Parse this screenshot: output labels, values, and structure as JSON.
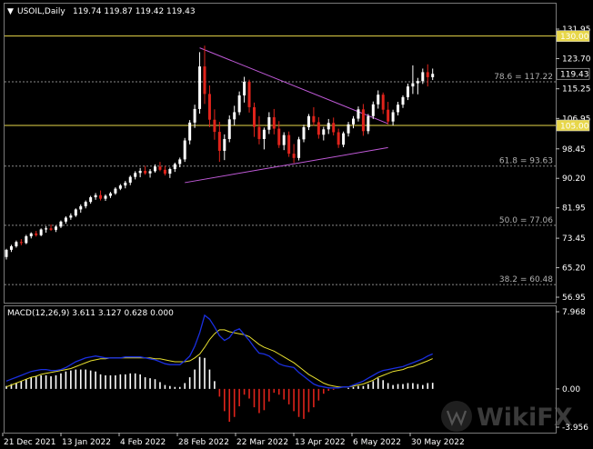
{
  "header": {
    "menu_glyph": "▼",
    "symbol": "USOIL,Daily",
    "ohlc": "119.74 119.87 119.42 119.43"
  },
  "price_axis": {
    "ticks": [
      "131.95",
      "123.70",
      "115.25",
      "106.95",
      "98.45",
      "90.20",
      "81.95",
      "73.45",
      "65.20",
      "56.95"
    ],
    "ylim": [
      56.95,
      131.95
    ],
    "level_130": "130.00",
    "level_105": "105.00",
    "current_price": "119.43"
  },
  "fibonacci": [
    {
      "label": "78.6 = 117.22",
      "value": 117.22
    },
    {
      "label": "61.8 = 93.63",
      "value": 93.63
    },
    {
      "label": "50.0 = 77.06",
      "value": 77.06
    },
    {
      "label": "38.2 = 60.48",
      "value": 60.48
    }
  ],
  "macd": {
    "label": "MACD(12,26,9) 3.611 3.127 0.628 0.000",
    "ticks": [
      "7.968",
      "0.00",
      "-3.956"
    ],
    "ylim": [
      -3.956,
      7.968
    ]
  },
  "time_axis": {
    "labels": [
      "21 Dec 2021",
      "13 Jan 2022",
      "4 Feb 2022",
      "28 Feb 2022",
      "22 Mar 2022",
      "13 Apr 2022",
      "6 May 2022",
      "30 May 2022"
    ]
  },
  "watermark": {
    "text": "WikiFX"
  },
  "colors": {
    "background": "#000000",
    "bull": "#ffffff",
    "bear": "#e0231b",
    "level_line": "#e8d74a",
    "fib_line": "#8a8a8a",
    "trendline": "#c05ad8",
    "macd_line": "#1a2fe0",
    "signal_line": "#e8e030",
    "hist_pos": "#ffffff",
    "hist_neg": "#e0231b"
  },
  "chart_data": {
    "type": "candlestick",
    "title": "USOIL,Daily",
    "candles": [
      [
        68.2,
        70.5,
        67.5,
        70.2
      ],
      [
        70.2,
        71.6,
        69.6,
        71.2
      ],
      [
        71.2,
        72.8,
        70.8,
        72.4
      ],
      [
        72.4,
        73.2,
        71.5,
        72.1
      ],
      [
        72.1,
        74.4,
        71.8,
        74.0
      ],
      [
        74.0,
        75.1,
        73.4,
        74.8
      ],
      [
        74.8,
        75.5,
        73.9,
        74.3
      ],
      [
        74.3,
        76.2,
        74.0,
        75.9
      ],
      [
        75.9,
        76.8,
        75.0,
        76.2
      ],
      [
        76.2,
        77.3,
        75.5,
        75.8
      ],
      [
        75.8,
        77.0,
        75.2,
        76.7
      ],
      [
        76.7,
        78.4,
        76.3,
        78.1
      ],
      [
        78.1,
        79.6,
        77.5,
        79.2
      ],
      [
        79.2,
        80.4,
        78.6,
        79.8
      ],
      [
        79.8,
        81.8,
        79.4,
        81.5
      ],
      [
        81.5,
        82.9,
        80.6,
        82.4
      ],
      [
        82.4,
        84.0,
        81.8,
        83.6
      ],
      [
        83.6,
        85.3,
        83.1,
        84.9
      ],
      [
        84.9,
        86.1,
        84.2,
        85.5
      ],
      [
        85.5,
        86.8,
        84.0,
        84.5
      ],
      [
        84.5,
        85.7,
        83.9,
        85.3
      ],
      [
        85.3,
        86.4,
        84.7,
        86.0
      ],
      [
        86.0,
        87.7,
        85.6,
        87.3
      ],
      [
        87.3,
        88.6,
        86.9,
        88.2
      ],
      [
        88.2,
        89.5,
        87.4,
        89.0
      ],
      [
        89.0,
        91.0,
        88.3,
        90.6
      ],
      [
        90.6,
        92.2,
        89.9,
        91.7
      ],
      [
        91.7,
        93.1,
        90.5,
        92.3
      ],
      [
        92.3,
        93.7,
        91.2,
        91.6
      ],
      [
        91.6,
        92.8,
        90.4,
        92.2
      ],
      [
        92.2,
        94.1,
        91.8,
        93.5
      ],
      [
        93.5,
        94.8,
        92.2,
        92.6
      ],
      [
        92.6,
        93.7,
        91.0,
        91.5
      ],
      [
        91.5,
        93.2,
        90.3,
        92.8
      ],
      [
        92.8,
        94.6,
        92.0,
        94.2
      ],
      [
        94.2,
        96.0,
        93.3,
        95.5
      ],
      [
        95.5,
        101.5,
        94.8,
        100.8
      ],
      [
        100.8,
        106.5,
        99.7,
        105.8
      ],
      [
        105.8,
        110.8,
        104.3,
        109.6
      ],
      [
        109.6,
        125.5,
        108.3,
        121.5
      ],
      [
        121.5,
        127.3,
        111.0,
        113.8
      ],
      [
        113.8,
        116.2,
        104.5,
        106.6
      ],
      [
        106.6,
        109.5,
        101.0,
        103.2
      ],
      [
        103.2,
        106.0,
        94.8,
        97.9
      ],
      [
        97.9,
        102.5,
        95.3,
        101.2
      ],
      [
        101.2,
        107.8,
        100.3,
        106.7
      ],
      [
        106.7,
        110.5,
        105.0,
        108.7
      ],
      [
        108.7,
        114.5,
        107.9,
        113.4
      ],
      [
        113.4,
        118.6,
        111.4,
        117.2
      ],
      [
        117.2,
        117.8,
        108.6,
        110.1
      ],
      [
        110.1,
        111.4,
        101.8,
        104.6
      ],
      [
        104.6,
        107.6,
        99.7,
        101.2
      ],
      [
        101.2,
        104.4,
        98.3,
        103.8
      ],
      [
        103.8,
        108.7,
        102.6,
        107.3
      ],
      [
        107.3,
        109.6,
        102.5,
        104.1
      ],
      [
        104.1,
        106.2,
        98.7,
        99.5
      ],
      [
        99.5,
        103.1,
        98.1,
        102.3
      ],
      [
        102.3,
        103.3,
        96.2,
        97.1
      ],
      [
        97.1,
        99.8,
        94.5,
        95.9
      ],
      [
        95.9,
        101.8,
        95.2,
        101.1
      ],
      [
        101.1,
        105.2,
        100.3,
        104.5
      ],
      [
        104.5,
        108.2,
        103.7,
        107.6
      ],
      [
        107.6,
        110.1,
        104.9,
        105.9
      ],
      [
        105.9,
        107.3,
        101.3,
        102.4
      ],
      [
        102.4,
        104.6,
        100.8,
        103.9
      ],
      [
        103.9,
        106.8,
        102.6,
        105.7
      ],
      [
        105.7,
        107.2,
        102.2,
        103.1
      ],
      [
        103.1,
        104.1,
        98.7,
        99.6
      ],
      [
        99.6,
        103.3,
        98.9,
        102.8
      ],
      [
        102.8,
        106.0,
        101.9,
        105.3
      ],
      [
        105.3,
        107.6,
        104.2,
        106.9
      ],
      [
        106.9,
        110.3,
        106.1,
        109.5
      ],
      [
        109.5,
        111.0,
        102.1,
        103.4
      ],
      [
        103.4,
        108.2,
        102.6,
        107.6
      ],
      [
        107.6,
        111.7,
        106.8,
        110.9
      ],
      [
        110.9,
        114.8,
        109.7,
        113.6
      ],
      [
        113.6,
        114.2,
        108.2,
        109.4
      ],
      [
        109.4,
        111.6,
        105.3,
        106.1
      ],
      [
        106.1,
        109.4,
        105.0,
        108.7
      ],
      [
        108.7,
        111.6,
        107.8,
        110.8
      ],
      [
        110.8,
        113.4,
        109.9,
        112.9
      ],
      [
        112.9,
        116.7,
        112.1,
        115.9
      ],
      [
        115.9,
        121.8,
        113.8,
        116.8
      ],
      [
        116.8,
        118.3,
        113.7,
        117.4
      ],
      [
        117.4,
        120.9,
        116.6,
        119.9
      ],
      [
        119.9,
        122.1,
        115.9,
        118.5
      ],
      [
        118.5,
        120.9,
        117.7,
        119.43
      ]
    ],
    "trendlines": [
      {
        "from": [
          39,
          126.7
        ],
        "to": [
          77,
          105.5
        ]
      },
      {
        "from": [
          36,
          89.0
        ],
        "to": [
          77,
          98.8
        ]
      }
    ],
    "macd_series": {
      "histogram": [
        0.3,
        0.5,
        0.6,
        0.8,
        1.0,
        1.2,
        1.3,
        1.4,
        1.4,
        1.3,
        1.4,
        1.6,
        1.8,
        1.9,
        2.0,
        2.0,
        2.0,
        1.9,
        1.8,
        1.5,
        1.4,
        1.4,
        1.4,
        1.5,
        1.5,
        1.6,
        1.6,
        1.5,
        1.2,
        1.1,
        1.0,
        0.7,
        0.4,
        0.3,
        0.2,
        0.2,
        0.6,
        1.2,
        2.0,
        3.3,
        3.2,
        2.0,
        0.8,
        -0.8,
        -2.3,
        -3.4,
        -2.9,
        -1.8,
        -0.6,
        -1.0,
        -1.9,
        -2.5,
        -2.2,
        -1.3,
        -0.4,
        -0.6,
        -1.1,
        -1.6,
        -2.3,
        -2.9,
        -3.1,
        -2.4,
        -1.9,
        -1.2,
        -0.5,
        -0.2,
        -0.1,
        0.0,
        0.0,
        0.1,
        0.2,
        0.3,
        0.3,
        0.5,
        0.8,
        1.1,
        0.9,
        0.6,
        0.4,
        0.5,
        0.5,
        0.6,
        0.6,
        0.5,
        0.4,
        0.6,
        0.628
      ],
      "macd_line": [
        0.8,
        1.0,
        1.2,
        1.4,
        1.6,
        1.8,
        1.9,
        2.0,
        2.0,
        1.9,
        1.9,
        2.0,
        2.2,
        2.5,
        2.8,
        3.0,
        3.2,
        3.3,
        3.4,
        3.3,
        3.2,
        3.2,
        3.2,
        3.2,
        3.3,
        3.3,
        3.3,
        3.3,
        3.2,
        3.1,
        3.0,
        2.8,
        2.6,
        2.5,
        2.5,
        2.5,
        2.9,
        3.4,
        4.4,
        5.8,
        7.6,
        7.2,
        6.4,
        5.5,
        5.0,
        5.3,
        6.0,
        6.2,
        5.6,
        5.0,
        4.3,
        3.7,
        3.6,
        3.4,
        3.0,
        2.6,
        2.4,
        2.3,
        2.2,
        1.7,
        1.3,
        0.9,
        0.5,
        0.3,
        0.2,
        0.1,
        0.1,
        0.1,
        0.2,
        0.2,
        0.4,
        0.6,
        0.8,
        1.1,
        1.4,
        1.7,
        1.9,
        2.0,
        2.1,
        2.2,
        2.3,
        2.5,
        2.7,
        2.9,
        3.1,
        3.4,
        3.611
      ],
      "signal_line": [
        0.2,
        0.4,
        0.6,
        0.8,
        1.0,
        1.2,
        1.3,
        1.5,
        1.6,
        1.7,
        1.8,
        1.9,
        2.0,
        2.1,
        2.3,
        2.5,
        2.7,
        2.9,
        3.0,
        3.1,
        3.1,
        3.2,
        3.2,
        3.2,
        3.2,
        3.2,
        3.2,
        3.2,
        3.2,
        3.2,
        3.1,
        3.1,
        3.0,
        2.9,
        2.8,
        2.8,
        2.8,
        2.9,
        3.2,
        3.6,
        4.3,
        5.1,
        5.7,
        6.1,
        6.1,
        5.9,
        5.8,
        5.7,
        5.6,
        5.4,
        5.0,
        4.6,
        4.3,
        4.1,
        3.9,
        3.6,
        3.3,
        3.0,
        2.7,
        2.3,
        1.9,
        1.5,
        1.2,
        0.9,
        0.6,
        0.4,
        0.3,
        0.2,
        0.2,
        0.2,
        0.3,
        0.4,
        0.5,
        0.7,
        0.9,
        1.2,
        1.4,
        1.6,
        1.8,
        1.9,
        2.0,
        2.2,
        2.3,
        2.5,
        2.7,
        2.9,
        3.127
      ]
    }
  }
}
